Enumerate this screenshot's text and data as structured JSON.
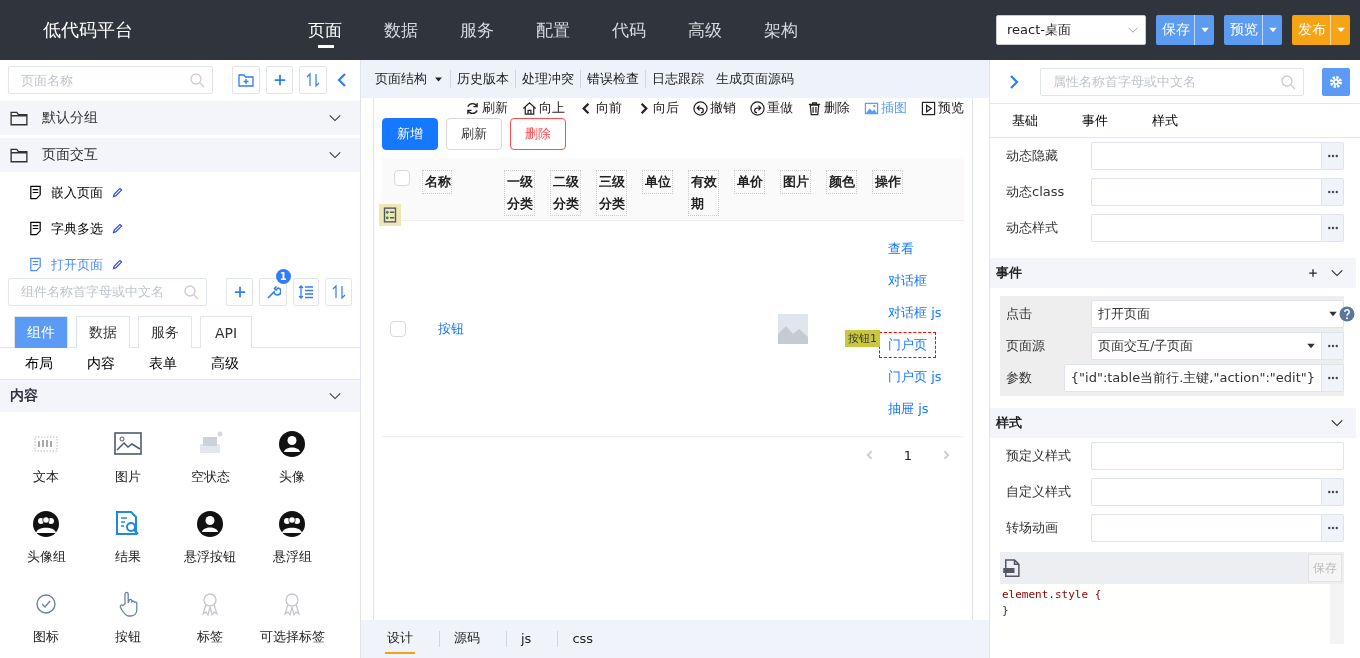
{
  "header": {
    "logo": "低代码平台",
    "nav": [
      {
        "label": "页面",
        "selected": true
      },
      {
        "label": "数据",
        "selected": false
      },
      {
        "label": "服务",
        "selected": false
      },
      {
        "label": "配置",
        "selected": false
      },
      {
        "label": "代码",
        "selected": false
      },
      {
        "label": "高级",
        "selected": false
      },
      {
        "label": "架构",
        "selected": false
      }
    ],
    "platform_select": {
      "value": "react-桌面"
    },
    "actions": [
      {
        "label": "保存",
        "kind": "primary"
      },
      {
        "label": "预览",
        "kind": "primary"
      },
      {
        "label": "发布",
        "kind": "warning"
      }
    ]
  },
  "page_panel": {
    "search": {
      "placeholder": "页面名称"
    },
    "tree": [
      {
        "label": "默认分组"
      },
      {
        "label": "页面交互",
        "children": [
          {
            "label": "嵌入页面",
            "selected": false
          },
          {
            "label": "字典多选",
            "selected": false
          },
          {
            "label": "打开页面",
            "selected": true
          }
        ]
      }
    ]
  },
  "component_panel": {
    "search": {
      "placeholder": "组件名称首字母或中文名"
    },
    "badge": "1",
    "tabs": [
      {
        "label": "组件",
        "selected": true
      },
      {
        "label": "数据",
        "selected": false
      },
      {
        "label": "服务",
        "selected": false
      },
      {
        "label": "API",
        "selected": false
      }
    ],
    "categories": [
      "布局",
      "内容",
      "表单",
      "高级"
    ],
    "section": "内容",
    "components": [
      {
        "label": "文本",
        "kind": "text"
      },
      {
        "label": "图片",
        "kind": "image"
      },
      {
        "label": "空状态",
        "kind": "empty"
      },
      {
        "label": "头像",
        "kind": "avatar"
      },
      {
        "label": "头像组",
        "kind": "avatar-group"
      },
      {
        "label": "结果",
        "kind": "result"
      },
      {
        "label": "悬浮按钮",
        "kind": "avatar"
      },
      {
        "label": "悬浮组",
        "kind": "avatar-group"
      },
      {
        "label": "图标",
        "kind": "check"
      },
      {
        "label": "按钮",
        "kind": "hand"
      },
      {
        "label": "标签",
        "kind": "ribbon"
      },
      {
        "label": "可选择标签",
        "kind": "ribbon"
      }
    ]
  },
  "designer": {
    "toolbar": [
      {
        "label": "页面结构",
        "dropdown": true
      },
      {
        "label": "历史版本",
        "dropdown": false
      },
      {
        "label": "处理冲突",
        "dropdown": false
      },
      {
        "label": "错误检查",
        "dropdown": false
      },
      {
        "label": "日志跟踪",
        "dropdown": false
      },
      {
        "label": "生成页面源码",
        "dropdown": false
      }
    ],
    "actions": [
      {
        "label": "刷新",
        "kind": "refresh",
        "active": false
      },
      {
        "label": "向上",
        "kind": "home",
        "active": false
      },
      {
        "label": "向前",
        "kind": "back",
        "active": false
      },
      {
        "label": "向后",
        "kind": "forward",
        "active": false
      },
      {
        "label": "撤销",
        "kind": "undo",
        "active": false
      },
      {
        "label": "重做",
        "kind": "redo",
        "active": false
      },
      {
        "label": "删除",
        "kind": "trash",
        "active": false
      },
      {
        "label": "插图",
        "kind": "image",
        "active": true
      },
      {
        "label": "预览",
        "kind": "play",
        "active": false
      }
    ],
    "buttons": [
      {
        "label": "新增",
        "kind": "primary"
      },
      {
        "label": "刷新",
        "kind": "default"
      },
      {
        "label": "删除",
        "kind": "danger"
      }
    ],
    "table": {
      "all_checked": false,
      "columns": [
        "名称",
        "一级分类",
        "二级分类",
        "三级分类",
        "单位",
        "有效期",
        "单价",
        "图片",
        "颜色",
        "操作"
      ],
      "rows": [
        {
          "checked": false,
          "name": "按钮",
          "operations": [
            {
              "label": "查看",
              "selected": false
            },
            {
              "label": "对话框",
              "selected": false
            },
            {
              "label": "对话框 js",
              "selected": false
            },
            {
              "label": "门户页",
              "selected": true
            },
            {
              "label": "门户页 js",
              "selected": false
            },
            {
              "label": "抽屉 js",
              "selected": false
            }
          ]
        }
      ]
    },
    "selection_tag": "按钮1",
    "pagination": {
      "page": "1"
    },
    "bottom_tabs": [
      {
        "label": "设计",
        "selected": true
      },
      {
        "label": "源码",
        "selected": false
      },
      {
        "label": "js",
        "selected": false
      },
      {
        "label": "css",
        "selected": false
      }
    ]
  },
  "properties": {
    "search": {
      "placeholder": "属性名称首字母或中文名"
    },
    "tabs": [
      "基础",
      "事件",
      "样式"
    ],
    "basic_fields": [
      {
        "label": "动态隐藏",
        "kind": "input",
        "more": true
      },
      {
        "label": "动态class",
        "kind": "input",
        "more": true
      },
      {
        "label": "动态样式",
        "kind": "input",
        "more": true
      }
    ],
    "events": {
      "title": "事件",
      "fields": [
        {
          "label": "点击",
          "kind": "select",
          "value": "打开页面",
          "more": false,
          "help": true
        },
        {
          "label": "页面源",
          "kind": "select",
          "value": "页面交互/子页面",
          "more": true,
          "help": false
        },
        {
          "label": "参数",
          "kind": "input",
          "value": "{\"id\":table当前行.主键,\"action\":\"edit\"}",
          "more": true,
          "help": false
        }
      ]
    },
    "styles": {
      "title": "样式",
      "fields": [
        {
          "label": "预定义样式",
          "kind": "input",
          "more": false
        },
        {
          "label": "自定义样式",
          "kind": "input",
          "more": true
        },
        {
          "label": "转场动画",
          "kind": "input",
          "more": true
        }
      ]
    },
    "css_editor": {
      "save": "保存",
      "disabled": true,
      "lines": [
        "element.style {",
        "}"
      ]
    }
  }
}
